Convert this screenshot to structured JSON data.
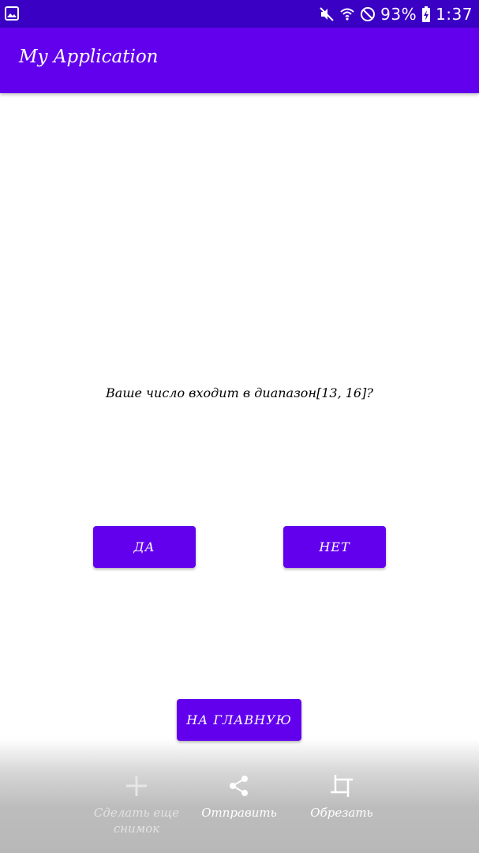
{
  "status_bar": {
    "battery": "93%",
    "time": "1:37",
    "icons": [
      "gallery-icon",
      "mute-icon",
      "wifi-icon",
      "do-not-disturb-icon",
      "battery-charging-icon"
    ]
  },
  "app_bar": {
    "title": "My Application"
  },
  "content": {
    "question": "Ваше число входит в диапазон[13, 16]?",
    "yes_label": "ДА",
    "no_label": "НЕТ",
    "home_label": "НА ГЛАВНУЮ"
  },
  "screenshot_toolbar": {
    "capture_more_label": "Сделать еще снимок",
    "share_label": "Отправить",
    "crop_label": "Обрезать"
  },
  "colors": {
    "primary": "#6200ee",
    "status_bar": "#3a00c4"
  }
}
